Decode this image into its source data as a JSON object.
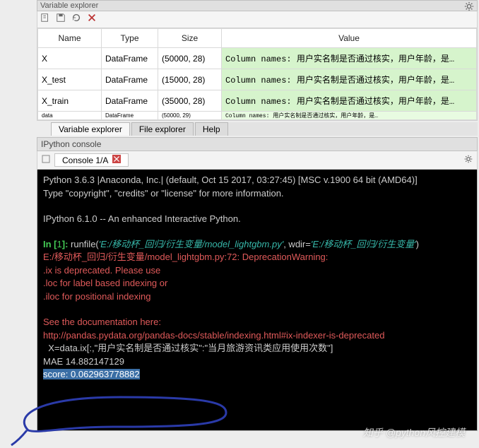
{
  "variable_explorer": {
    "title": "Variable explorer",
    "columns": {
      "name": "Name",
      "type": "Type",
      "size": "Size",
      "value": "Value"
    },
    "rows": [
      {
        "name": "X",
        "type": "DataFrame",
        "size": "(50000, 28)",
        "value": "Column names: 用户实名制是否通过核实，用户年龄，是…"
      },
      {
        "name": "X_test",
        "type": "DataFrame",
        "size": "(15000, 28)",
        "value": "Column names: 用户实名制是否通过核实，用户年龄，是…"
      },
      {
        "name": "X_train",
        "type": "DataFrame",
        "size": "(35000, 28)",
        "value": "Column names: 用户实名制是否通过核实，用户年龄，是…"
      },
      {
        "name": "data",
        "type": "DataFrame",
        "size": "(50000, 29)",
        "value": "Column names: 用户实名制是否通过核实，用户年龄，是…"
      }
    ]
  },
  "bottom_tabs": {
    "t1": "Variable explorer",
    "t2": "File explorer",
    "t3": "Help"
  },
  "console_panel": {
    "title": "IPython console",
    "tab": "Console 1/A"
  },
  "console": {
    "banner1": "Python 3.6.3 |Anaconda, Inc.| (default, Oct 15 2017, 03:27:45) [MSC v.1900 64 bit (AMD64)]",
    "banner2": "Type \"copyright\", \"credits\" or \"license\" for more information.",
    "banner3": "IPython 6.1.0 -- An enhanced Interactive Python.",
    "in_label": "In [",
    "in_num": "1",
    "in_close": "]: ",
    "runfile": "runfile(",
    "path1": "'E:/移动杯_回归/衍生变量/model_lightgbm.py'",
    "wdir": ", wdir=",
    "path2": "'E:/移动杯_回归/衍生变量'",
    "rpar": ")",
    "warn1": "E:/移动杯_回归/衍生变量/model_lightgbm.py:72: DeprecationWarning:",
    "warn2": ".ix is deprecated. Please use",
    "warn3": ".loc for label based indexing or",
    "warn4": ".iloc for positional indexing",
    "doc1": "See the documentation here:",
    "doc2": "http://pandas.pydata.org/pandas-docs/stable/indexing.html#ix-indexer-is-deprecated",
    "codeline": "  X=data.ix[:,\"用户实名制是否通过核实\":\"当月旅游资讯类应用使用次数\"]",
    "mae": "MAE 14.882147129",
    "score": "score: 0.062963778882"
  },
  "watermark": "知乎 @python风控建模"
}
